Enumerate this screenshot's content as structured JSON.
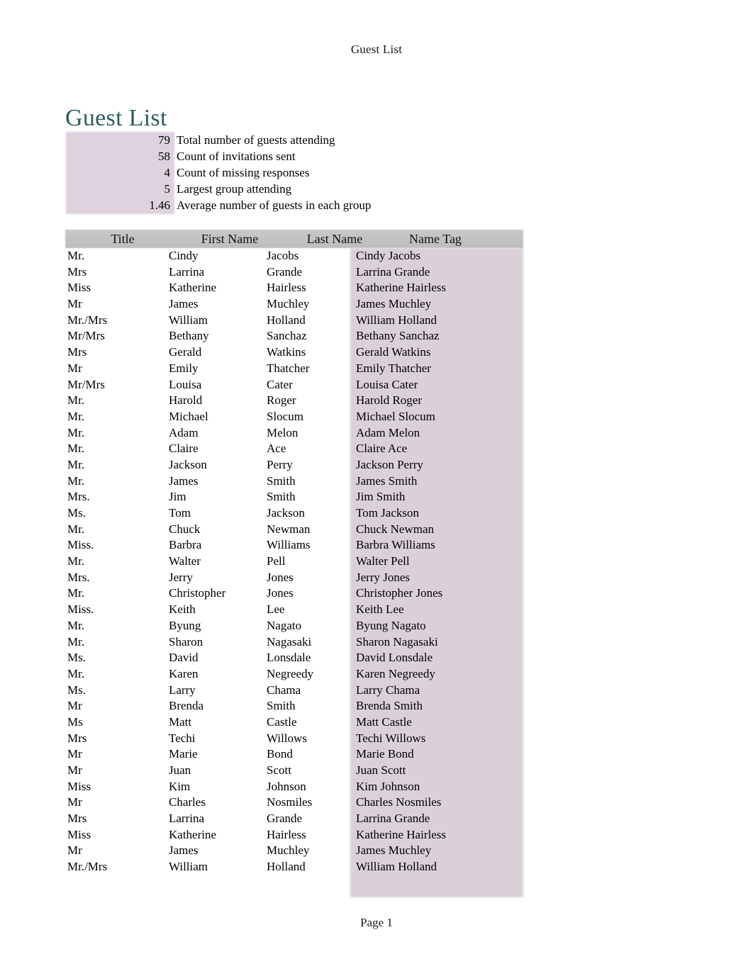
{
  "running_header": "Guest List",
  "title": "Guest List",
  "colors": {
    "title": "#2d5c63",
    "header_band": "#c2c2c2",
    "nametag_shade": "#dad0da",
    "summary_shade": "#ddd2dd"
  },
  "summary": [
    {
      "value": "79",
      "label": "Total number of guests attending"
    },
    {
      "value": "58",
      "label": "Count of invitations sent"
    },
    {
      "value": "4",
      "label": "Count of missing responses"
    },
    {
      "value": "5",
      "label": "Largest group attending"
    },
    {
      "value": "1.46",
      "label": "Average number of guests in each group"
    }
  ],
  "table": {
    "columns": [
      "Title",
      "First Name",
      "Last Name",
      "Name Tag"
    ],
    "rows": [
      {
        "title": "Mr.",
        "first": "Cindy",
        "last": "Jacobs",
        "nametag": "Cindy Jacobs"
      },
      {
        "title": "Mrs",
        "first": "Larrina",
        "last": "Grande",
        "nametag": "Larrina Grande"
      },
      {
        "title": "Miss",
        "first": "Katherine",
        "last": "Hairless",
        "nametag": "Katherine Hairless"
      },
      {
        "title": "Mr",
        "first": "James",
        "last": "Muchley",
        "nametag": "James Muchley"
      },
      {
        "title": "Mr./Mrs",
        "first": "William",
        "last": "Holland",
        "nametag": "William Holland"
      },
      {
        "title": "Mr/Mrs",
        "first": "Bethany",
        "last": "Sanchaz",
        "nametag": "Bethany Sanchaz"
      },
      {
        "title": "Mrs",
        "first": "Gerald",
        "last": "Watkins",
        "nametag": "Gerald Watkins"
      },
      {
        "title": "Mr",
        "first": "Emily",
        "last": "Thatcher",
        "nametag": "Emily Thatcher"
      },
      {
        "title": "Mr/Mrs",
        "first": "Louisa",
        "last": "Cater",
        "nametag": "Louisa Cater"
      },
      {
        "title": "Mr.",
        "first": "Harold",
        "last": "Roger",
        "nametag": "Harold Roger"
      },
      {
        "title": "Mr.",
        "first": "Michael",
        "last": "Slocum",
        "nametag": "Michael Slocum"
      },
      {
        "title": "Mr.",
        "first": "Adam",
        "last": "Melon",
        "nametag": "Adam Melon"
      },
      {
        "title": "Mr.",
        "first": "Claire",
        "last": "Ace",
        "nametag": "Claire Ace"
      },
      {
        "title": "Mr.",
        "first": "Jackson",
        "last": "Perry",
        "nametag": "Jackson Perry"
      },
      {
        "title": "Mr.",
        "first": "James",
        "last": "Smith",
        "nametag": "James Smith"
      },
      {
        "title": "Mrs.",
        "first": "Jim",
        "last": "Smith",
        "nametag": "Jim Smith"
      },
      {
        "title": "Ms.",
        "first": "Tom",
        "last": "Jackson",
        "nametag": "Tom Jackson"
      },
      {
        "title": "Mr.",
        "first": "Chuck",
        "last": "Newman",
        "nametag": "Chuck Newman"
      },
      {
        "title": "Miss.",
        "first": "Barbra",
        "last": "Williams",
        "nametag": "Barbra Williams"
      },
      {
        "title": "Mr.",
        "first": "Walter",
        "last": "Pell",
        "nametag": "Walter Pell"
      },
      {
        "title": "Mrs.",
        "first": "Jerry",
        "last": "Jones",
        "nametag": "Jerry Jones"
      },
      {
        "title": "Mr.",
        "first": "Christopher",
        "last": "Jones",
        "nametag": "Christopher Jones"
      },
      {
        "title": "Miss.",
        "first": "Keith",
        "last": "Lee",
        "nametag": "Keith Lee"
      },
      {
        "title": "Mr.",
        "first": "Byung",
        "last": "Nagato",
        "nametag": "Byung Nagato"
      },
      {
        "title": "Mr.",
        "first": "Sharon",
        "last": "Nagasaki",
        "nametag": "Sharon Nagasaki"
      },
      {
        "title": "Ms.",
        "first": "David",
        "last": "Lonsdale",
        "nametag": "David Lonsdale"
      },
      {
        "title": "Mr.",
        "first": "Karen",
        "last": "Negreedy",
        "nametag": "Karen Negreedy"
      },
      {
        "title": "Ms.",
        "first": "Larry",
        "last": "Chama",
        "nametag": "Larry Chama"
      },
      {
        "title": "Mr",
        "first": "Brenda",
        "last": "Smith",
        "nametag": "Brenda Smith"
      },
      {
        "title": "Ms",
        "first": "Matt",
        "last": "Castle",
        "nametag": "Matt Castle"
      },
      {
        "title": "Mrs",
        "first": "Techi",
        "last": "Willows",
        "nametag": "Techi Willows"
      },
      {
        "title": "Mr",
        "first": "Marie",
        "last": "Bond",
        "nametag": "Marie Bond"
      },
      {
        "title": "Mr",
        "first": "Juan",
        "last": "Scott",
        "nametag": "Juan Scott"
      },
      {
        "title": "Miss",
        "first": "Kim",
        "last": "Johnson",
        "nametag": "Kim Johnson"
      },
      {
        "title": "Mr",
        "first": "Charles",
        "last": "Nosmiles",
        "nametag": "Charles Nosmiles"
      },
      {
        "title": "Mrs",
        "first": "Larrina",
        "last": "Grande",
        "nametag": "Larrina Grande"
      },
      {
        "title": "Miss",
        "first": "Katherine",
        "last": "Hairless",
        "nametag": "Katherine Hairless"
      },
      {
        "title": "Mr",
        "first": "James",
        "last": "Muchley",
        "nametag": "James Muchley"
      },
      {
        "title": "Mr./Mrs",
        "first": "William",
        "last": "Holland",
        "nametag": "William Holland"
      }
    ]
  },
  "footer": "Page 1"
}
